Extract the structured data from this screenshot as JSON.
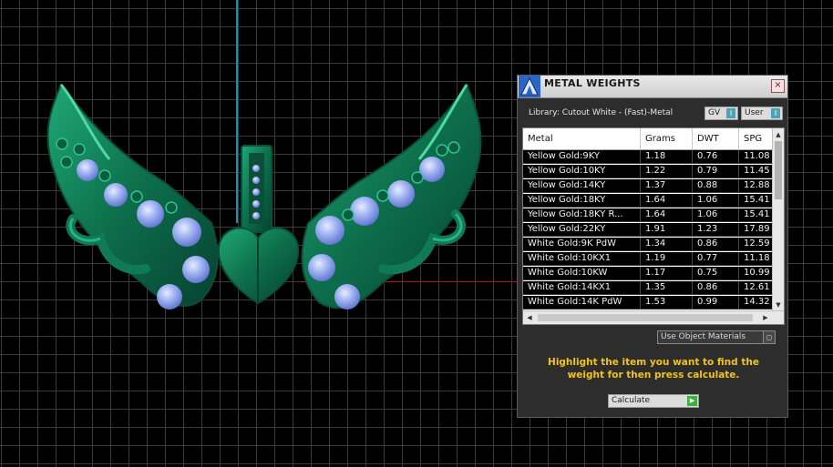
{
  "window": {
    "title": "METAL WEIGHTS",
    "close_label": "×"
  },
  "library": {
    "label": "Library: Cutout White - (Fast)-Metal"
  },
  "toggles": {
    "gv_label": "GV",
    "user_label": "User",
    "knob_glyph": "I"
  },
  "table": {
    "headers": [
      "Metal",
      "Grams",
      "DWT",
      "SPG"
    ],
    "rows": [
      [
        "Yellow Gold:9KY",
        "1.18",
        "0.76",
        "11.08"
      ],
      [
        "Yellow Gold:10KY",
        "1.22",
        "0.79",
        "11.45"
      ],
      [
        "Yellow Gold:14KY",
        "1.37",
        "0.88",
        "12.88"
      ],
      [
        "Yellow Gold:18KY",
        "1.64",
        "1.06",
        "15.41"
      ],
      [
        "Yellow Gold:18KY R...",
        "1.64",
        "1.06",
        "15.41"
      ],
      [
        "Yellow Gold:22KY",
        "1.91",
        "1.23",
        "17.89"
      ],
      [
        "White Gold:9K PdW",
        "1.34",
        "0.86",
        "12.59"
      ],
      [
        "White Gold:10KX1",
        "1.19",
        "0.77",
        "11.18"
      ],
      [
        "White Gold:10KW",
        "1.17",
        "0.75",
        "10.99"
      ],
      [
        "White Gold:14KX1",
        "1.35",
        "0.86",
        "12.61"
      ],
      [
        "White Gold:14K PdW",
        "1.53",
        "0.99",
        "14.32"
      ]
    ]
  },
  "options": {
    "use_object_materials": "Use Object Materials"
  },
  "instructions": "Highlight the item you want to find the weight for then press calculate.",
  "calculate": {
    "label": "Calculate"
  },
  "colors": {
    "model_green": "#0d6e4c",
    "gem_blue": "#8fa7ee",
    "instruction_yellow": "#f2c31a",
    "viewport_grid": "#3a3a3a"
  }
}
